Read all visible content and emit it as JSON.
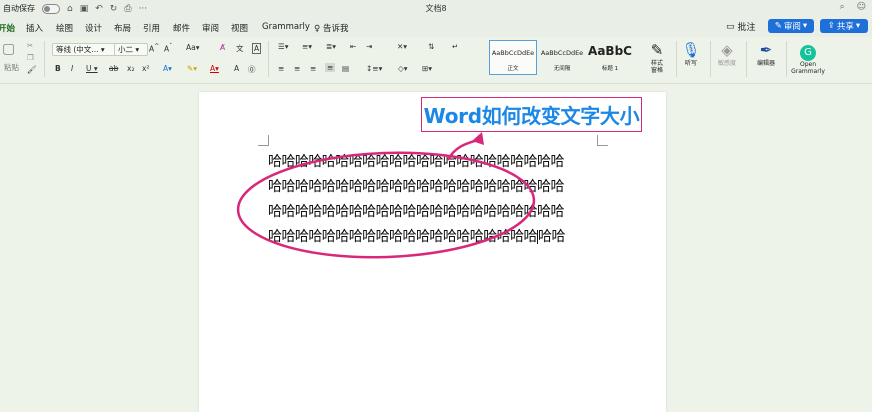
{
  "titlebar": {
    "autosave_label": "自动保存",
    "document_title": "文档8"
  },
  "tabs": [
    {
      "label": "开始",
      "active": true
    },
    {
      "label": "插入"
    },
    {
      "label": "绘图"
    },
    {
      "label": "设计"
    },
    {
      "label": "布局"
    },
    {
      "label": "引用"
    },
    {
      "label": "邮件"
    },
    {
      "label": "审阅"
    },
    {
      "label": "视图"
    },
    {
      "label": "Grammarly"
    },
    {
      "label": "告诉我"
    }
  ],
  "actions": {
    "comments": "批注",
    "review": "审阅",
    "share": "共享"
  },
  "ribbon": {
    "paste_label": "粘贴",
    "font_name": "等线 (中文...",
    "font_size": "小二",
    "styles": [
      {
        "sample": "AaBbCcDdEe",
        "name": "正文"
      },
      {
        "sample": "AaBbCcDdEe",
        "name": "无间隔"
      },
      {
        "sample": "AaBbC",
        "name": "标题 1"
      }
    ],
    "styles_pane": "样式\n窗格",
    "dictate": "听写",
    "sensitivity": "敏感度",
    "editor": "编辑器",
    "open_grammarly": "Open\nGrammarly"
  },
  "document": {
    "heading": "Word如何改变文字大小",
    "lines": [
      "哈哈哈哈哈哈哈哈哈哈哈哈哈哈哈哈哈哈哈哈哈哈",
      "哈哈哈哈哈哈哈哈哈哈哈哈哈哈哈哈哈哈哈哈哈哈",
      "哈哈哈哈哈哈哈哈哈哈哈哈哈哈哈哈哈哈哈哈哈哈",
      "哈哈哈哈哈哈哈哈哈哈哈哈哈哈哈哈哈哈哈哈"
    ],
    "last_line_after_cursor": "哈哈"
  },
  "colors": {
    "accent_blue": "#1f6fd8",
    "heading_blue": "#1b87e6",
    "annotation_pink": "#d8287a",
    "active_tab_green": "#2a7b2a"
  }
}
